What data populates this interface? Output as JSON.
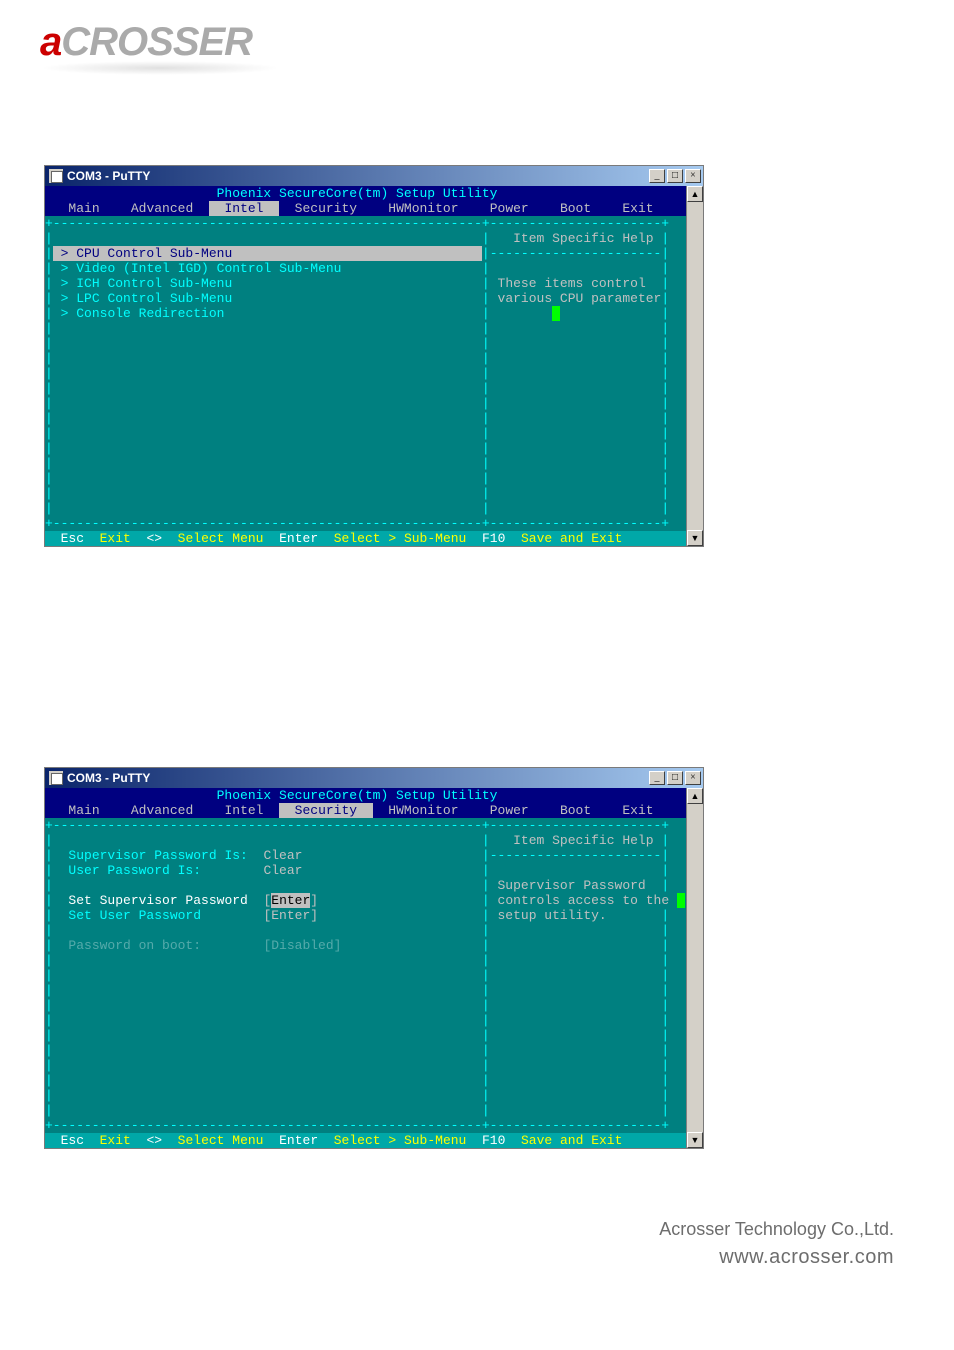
{
  "logo": {
    "first": "a",
    "rest": "CROSSER"
  },
  "window_title": "COM3 - PuTTY",
  "bios_title": "Phoenix SecureCore(tm) Setup Utility",
  "tabs": [
    "Main",
    "Advanced",
    "Intel",
    "Security",
    "HWMonitor",
    "Power",
    "Boot",
    "Exit"
  ],
  "screen1": {
    "active_tab": "Intel",
    "items": [
      "CPU Control Sub-Menu",
      "Video (Intel IGD) Control Sub-Menu",
      "ICH Control Sub-Menu",
      "LPC Control Sub-Menu",
      "Console Redirection"
    ],
    "help_title": "Item Specific Help",
    "help_lines": [
      "These items control",
      "various CPU parameters."
    ]
  },
  "screen2": {
    "active_tab": "Security",
    "rows": [
      {
        "label": "Supervisor Password Is:",
        "value": "Clear",
        "type": "readonly"
      },
      {
        "label": "User Password Is:",
        "value": "Clear",
        "type": "readonly"
      },
      {
        "label": "",
        "value": "",
        "type": "blank"
      },
      {
        "label": "Set Supervisor Password",
        "value": "[Enter]",
        "type": "selected"
      },
      {
        "label": "Set User Password",
        "value": "[Enter]",
        "type": "normal"
      },
      {
        "label": "",
        "value": "",
        "type": "blank"
      },
      {
        "label": "Password on boot:",
        "value": "[Disabled]",
        "type": "dim"
      }
    ],
    "help_title": "Item Specific Help",
    "help_lines": [
      "Supervisor Password",
      "controls access to the ",
      "setup utility."
    ]
  },
  "keybar": [
    {
      "key": "Esc",
      "label": "Exit"
    },
    {
      "key": "<>",
      "label": "Select Menu"
    },
    {
      "key": "Enter",
      "label": "Select > Sub-Menu"
    },
    {
      "key": "F10",
      "label": "Save and Exit"
    }
  ],
  "footer": {
    "company": "Acrosser Technology Co.,Ltd.",
    "url": "www.acrosser.com"
  }
}
